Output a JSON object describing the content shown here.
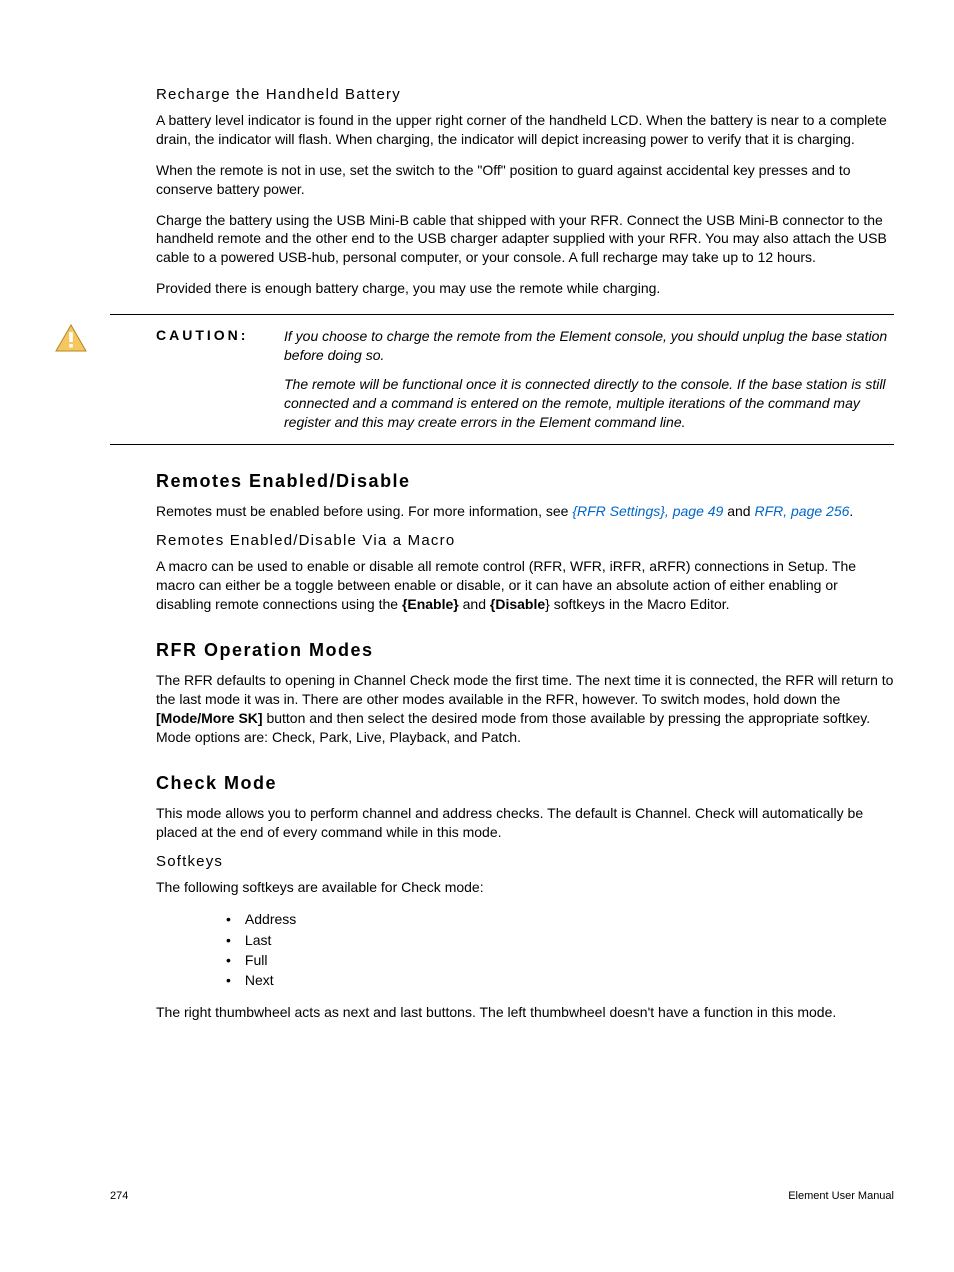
{
  "sections": {
    "recharge": {
      "heading": "Recharge the Handheld Battery",
      "p1": "A battery level indicator is found in the upper right corner of the handheld LCD. When the battery is near to a complete drain, the indicator will flash. When charging, the indicator will depict increasing power to verify that it is charging.",
      "p2": "When the remote is not in use, set the switch to the \"Off\" position to guard against accidental key presses and to conserve battery power.",
      "p3": "Charge the battery using the USB Mini-B cable that shipped with your RFR. Connect the USB Mini-B connector to the handheld remote and the other end to the USB charger adapter supplied with your RFR. You may also attach the USB cable to a powered USB-hub, personal computer, or your console. A full recharge may take up to 12 hours.",
      "p4": "Provided there is enough battery charge, you may use the remote while charging."
    },
    "caution": {
      "label": "CAUTION:",
      "p1": "If you choose to charge the remote from the Element console, you should unplug the base station before doing so.",
      "p2": "The remote will be functional once it is connected directly to the console. If the base station is still connected and a command is entered on the remote, multiple iterations of the command may register and this may create errors in the Element command line."
    },
    "remotes_enable": {
      "heading": "Remotes Enabled/Disable",
      "p1_a": "Remotes must be enabled before using. For more information, see ",
      "link1": "{RFR Settings}, page 49",
      "p1_b": " and ",
      "link2": "RFR, page 256",
      "p1_c": ".",
      "sub_heading": "Remotes Enabled/Disable Via a Macro",
      "p2_a": "A macro can be used to enable or disable all remote control (RFR, WFR, iRFR, aRFR) connections in Setup. The macro can either be a toggle between enable or disable, or it can have an absolute action of either enabling or disabling remote connections using the ",
      "bold1": "{Enable}",
      "p2_b": " and ",
      "bold2": "{Disable",
      "p2_c": "} softkeys in the Macro Editor."
    },
    "rfr_modes": {
      "heading": "RFR Operation Modes",
      "p1_a": "The RFR defaults to opening in Channel Check mode the first time. The next time it is connected, the RFR will return to the last mode it was in. There are other modes available in the RFR, however. To switch modes, hold down the ",
      "bold1": "[Mode/More SK]",
      "p1_b": " button and then select the desired mode from those available by pressing the appropriate softkey. Mode options are: Check, Park, Live, Playback, and Patch."
    },
    "check_mode": {
      "heading": "Check Mode",
      "p1": "This mode allows you to perform channel and address checks. The default is Channel. Check will automatically be placed at the end of every command while in this mode.",
      "sub_heading": "Softkeys",
      "p2": "The following softkeys are available for Check mode:",
      "list": [
        "Address",
        "Last",
        "Full",
        "Next"
      ],
      "p3": "The right thumbwheel acts as next and last buttons. The left thumbwheel doesn't have a function in this mode."
    }
  },
  "footer": {
    "page_num": "274",
    "manual": "Element User Manual"
  }
}
